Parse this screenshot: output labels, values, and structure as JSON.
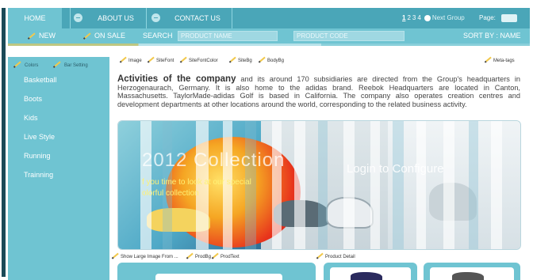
{
  "nav": {
    "tabs": [
      {
        "label": "HOME"
      },
      {
        "label": "ABOUT US"
      },
      {
        "label": "CONTACT US"
      }
    ],
    "pager": {
      "pages": [
        "1",
        "2",
        "3",
        "4"
      ],
      "next_label": "Next Group",
      "page_label": "Page:"
    }
  },
  "subnav": {
    "new_label": "NEW",
    "onsale_label": "ON SALE",
    "search_label": "SEARCH",
    "product_name_placeholder": "PRODUCT NAME",
    "product_code_placeholder": "PRODUCT CODE",
    "sort_label": "SORT BY : NAME"
  },
  "sidebar": {
    "tools": {
      "colors": "Colors",
      "bar_setting": "Bar Setting"
    },
    "items": [
      {
        "label": "Basketball"
      },
      {
        "label": "Boots"
      },
      {
        "label": "Kids"
      },
      {
        "label": "Live Style"
      },
      {
        "label": "Running"
      },
      {
        "label": "Trainning"
      }
    ]
  },
  "toolbar": {
    "links": [
      "Image",
      "SiteFont",
      "SiteFontColor",
      "SiteBg",
      "BodyBg"
    ],
    "meta": "Meta-tags"
  },
  "article": {
    "heading": "Activities of the company",
    "body": " and its around 170 subsidiaries are directed from the Group's headquarters in Herzogenaurach, Germany. It is also home to the adidas brand. Reebok Headquarters are located in Canton, Massachusetts. TaylorMade-adidas Golf is based in California. The company also operates creation centres and development departments at other locations around the world, corresponding to the related business activity."
  },
  "banner": {
    "title": "2012 Collection",
    "sub1": "f you time to look at our special",
    "sub2": "olorful collection",
    "login": "Login to Configure"
  },
  "bottom": {
    "links": [
      "Show Large Image From ...",
      "ProdBg",
      "ProdText"
    ],
    "detail": "Product Detail"
  },
  "colors": {
    "nav_dark": "#4aa6b8",
    "nav_light": "#6fc4d2",
    "accent_yellow": "#f2c94c",
    "white": "#ffffff"
  }
}
